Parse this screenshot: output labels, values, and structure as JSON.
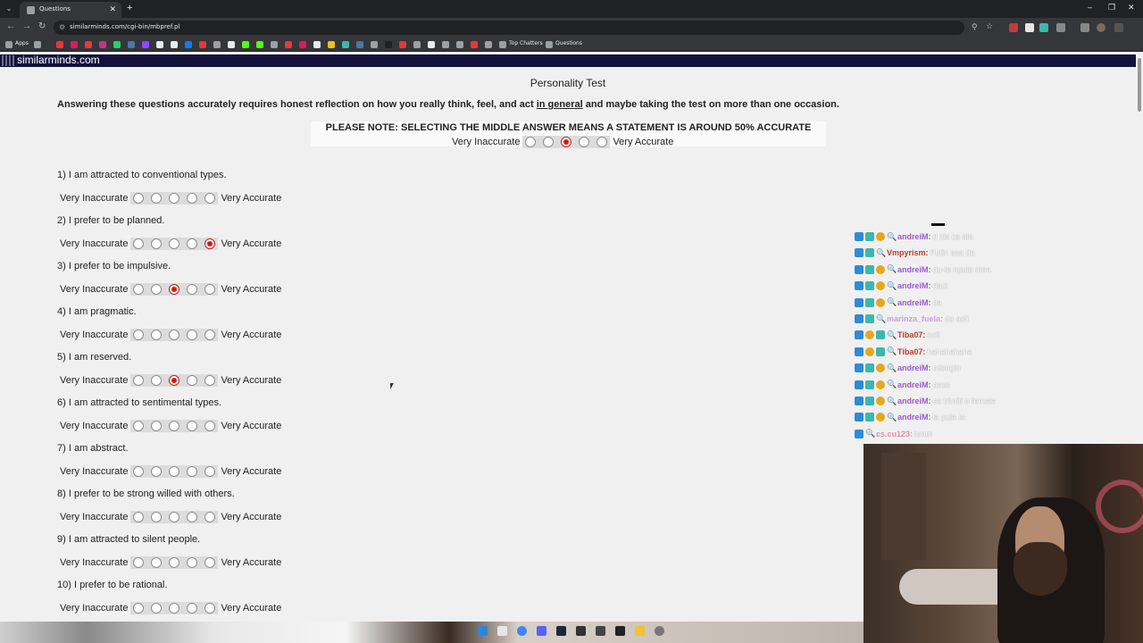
{
  "browser": {
    "tab_title": "Questions",
    "url": "similarminds.com/cgi-bin/mbpref.pl",
    "bookmarks": {
      "apps_label": "Apps",
      "top_chatters_label": "Top Chatters",
      "questions_label": "Questions"
    }
  },
  "site": {
    "logo": "similarminds.com"
  },
  "page": {
    "title": "Personality Test",
    "intro_before": "Answering these questions accurately requires honest reflection on how you really think, feel, and act ",
    "intro_link": "in general",
    "intro_after": " and maybe taking the test on more than one occasion.",
    "note": "PLEASE NOTE: SELECTING THE MIDDLE ANSWER MEANS A STATEMENT IS AROUND 50% ACCURATE",
    "scale_left": "Very Inaccurate",
    "scale_right": "Very Accurate",
    "example_selected": 3
  },
  "questions": [
    {
      "text": "1) I am attracted to conventional types.",
      "selected": 0
    },
    {
      "text": "2) I prefer to be planned.",
      "selected": 5
    },
    {
      "text": "3) I prefer to be impulsive.",
      "selected": 3
    },
    {
      "text": "4) I am pragmatic.",
      "selected": 0
    },
    {
      "text": "5) I am reserved.",
      "selected": 3
    },
    {
      "text": "6) I am attracted to sentimental types.",
      "selected": 0
    },
    {
      "text": "7) I am abstract.",
      "selected": 0
    },
    {
      "text": "8) I prefer to be strong willed with others.",
      "selected": 0
    },
    {
      "text": "9) I am attracted to silent people.",
      "selected": 0
    },
    {
      "text": "10) I prefer to be rational.",
      "selected": 0
    }
  ],
  "chat": {
    "lines": [
      {
        "user": "andreiM:",
        "msg": "d zis ca ala",
        "color": "#9b59d0",
        "badges": [
          "b-blue",
          "b-teal",
          "b-gold"
        ]
      },
      {
        "user": "Vmpyrism:",
        "msg": "Putin asa da",
        "color": "#c0392b",
        "badges": [
          "b-blue",
          "b-teal"
        ]
      },
      {
        "user": "andreiM:",
        "msg": "du-te npula mea",
        "color": "#9b59d0",
        "badges": [
          "b-blue",
          "b-teal",
          "b-gold"
        ]
      },
      {
        "user": "andreiM:",
        "msg": "dact",
        "color": "#9b59d0",
        "badges": [
          "b-blue",
          "b-teal",
          "b-gold"
        ]
      },
      {
        "user": "andreiM:",
        "msg": "da",
        "color": "#9b59d0",
        "badges": [
          "b-blue",
          "b-teal",
          "b-gold"
        ]
      },
      {
        "user": "marinza_fuela:",
        "msg": "da asti",
        "color": "#c9a0dc",
        "badges": [
          "b-blue",
          "b-teal"
        ]
      },
      {
        "user": "Tiba07:",
        "msg": "asti",
        "color": "#c0392b",
        "badges": [
          "b-blue",
          "b-gold",
          "b-teal"
        ]
      },
      {
        "user": "Tiba07:",
        "msg": "hahahahaha",
        "color": "#c0392b",
        "badges": [
          "b-blue",
          "b-gold",
          "b-teal"
        ]
      },
      {
        "user": "andreiM:",
        "msg": "misogin",
        "color": "#9b59d0",
        "badges": [
          "b-blue",
          "b-teal",
          "b-gold"
        ]
      },
      {
        "user": "andreiM:",
        "msg": "asos",
        "color": "#9b59d0",
        "badges": [
          "b-blue",
          "b-teal",
          "b-gold"
        ]
      },
      {
        "user": "andreiM:",
        "msg": "sa trimiti o femeie",
        "color": "#9b59d0",
        "badges": [
          "b-blue",
          "b-teal",
          "b-gold"
        ]
      },
      {
        "user": "andreiM:",
        "msg": "la pula ta",
        "color": "#9b59d0",
        "badges": [
          "b-blue",
          "b-teal",
          "b-gold"
        ]
      },
      {
        "user": "cs.cu123:",
        "msg": "hmm",
        "color": "#e08fa8",
        "badges": [
          "b-blue"
        ]
      }
    ]
  }
}
